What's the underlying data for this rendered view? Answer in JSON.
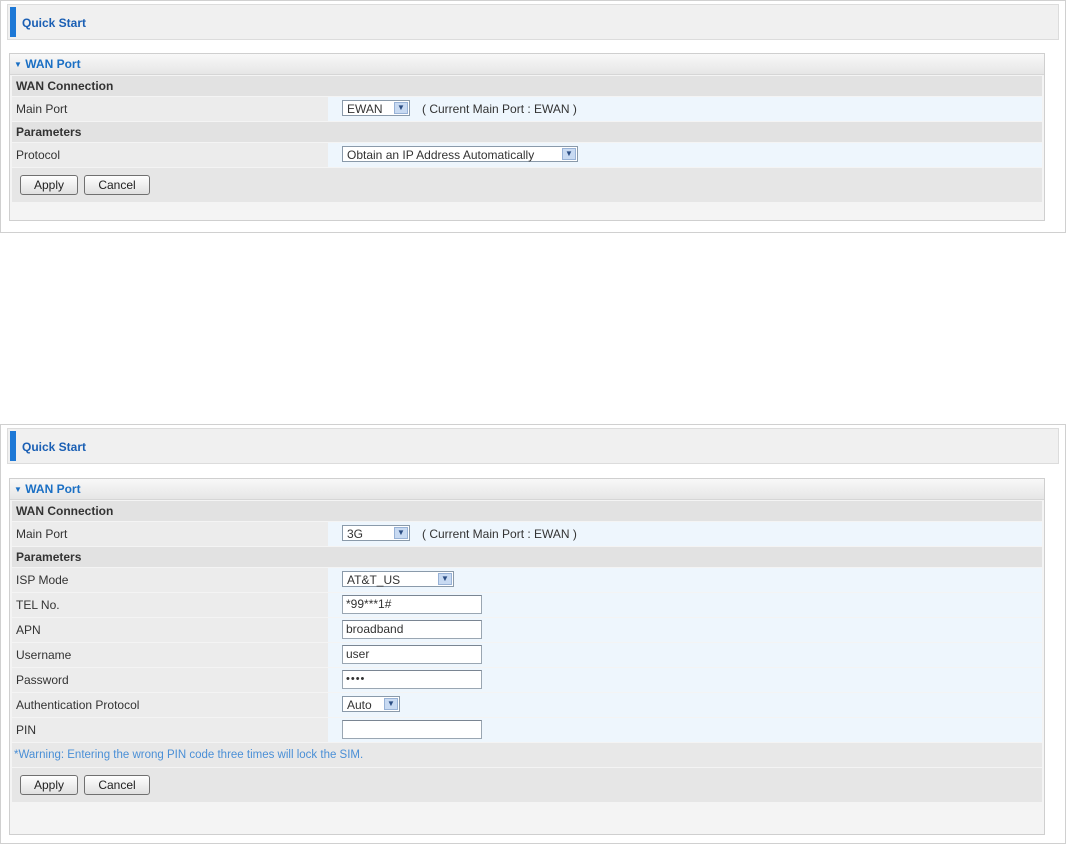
{
  "panel1": {
    "quick_start": "Quick Start",
    "wan_port": "WAN Port",
    "wan_connection": "WAN Connection",
    "main_port_label": "Main Port",
    "main_port_value": "EWAN",
    "current_main_port": "( Current Main Port : EWAN )",
    "parameters": "Parameters",
    "protocol_label": "Protocol",
    "protocol_value": "Obtain an IP Address Automatically",
    "apply": "Apply",
    "cancel": "Cancel"
  },
  "panel2": {
    "quick_start": "Quick Start",
    "wan_port": "WAN Port",
    "wan_connection": "WAN Connection",
    "main_port_label": "Main Port",
    "main_port_value": "3G",
    "current_main_port": "( Current Main Port : EWAN )",
    "parameters": "Parameters",
    "isp_mode_label": "ISP Mode",
    "isp_mode_value": "AT&T_US",
    "tel_label": "TEL No.",
    "tel_value": "*99***1#",
    "apn_label": "APN",
    "apn_value": "broadband",
    "username_label": "Username",
    "username_value": "user",
    "password_label": "Password",
    "password_value": "••••",
    "auth_label": "Authentication Protocol",
    "auth_value": "Auto",
    "pin_label": "PIN",
    "pin_value": "",
    "warning": "*Warning: Entering the wrong PIN code three times will lock the SIM.",
    "apply": "Apply",
    "cancel": "Cancel"
  },
  "icons": {
    "dropdown_arrow": "chevron-down-icon",
    "collapse_triangle": "triangle-down-icon"
  },
  "colors": {
    "accent": "#1d78d6",
    "title_text": "#1a5fb4",
    "warning_text": "#4a8fd6"
  }
}
